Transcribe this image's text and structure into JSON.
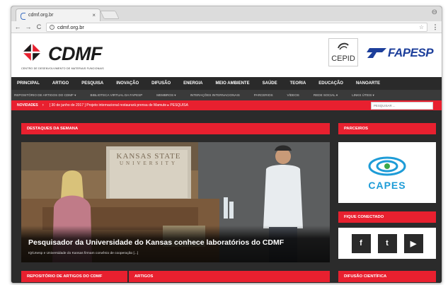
{
  "browser": {
    "tab_title": "cdmf.org.br",
    "tab_close": "×",
    "url": "cdmf.org.br",
    "back": "←",
    "forward": "→",
    "reload": "C",
    "info": "i",
    "star": "☆",
    "menu": "⋮",
    "profile": "⊖"
  },
  "header": {
    "brand": "CDMF",
    "tagline": "CENTRO DE DESENVOLVIMENTO DE MATERIAIS FUNCIONAIS",
    "cepid_label": "CEPID",
    "fapesp_label": "FAPESP"
  },
  "main_nav": [
    "PRINCIPAL",
    "ARTIGO",
    "PESQUISA",
    "INOVAÇÃO",
    "DIFUSÃO",
    "ENERGIA",
    "MEIO AMBIENTE",
    "SAÚDE",
    "TEORIA",
    "EDUCAÇÃO",
    "NANOARTE"
  ],
  "sub_nav": [
    "REPOSITÓRIO DE ARTIGOS DO CDMF ▾",
    "BIBLIOTECA VIRTUAL DA FAPESP",
    "MEMBROS ▾",
    "INTERAÇÕES INTERNACIONAIS",
    "PARCERIOS",
    "VÍDEOS",
    "REDE SOCIAL ▾",
    "LINKS ÚTEIS ▾"
  ],
  "ticker": {
    "label": "NOVIDADES",
    "arrow": "›",
    "text": "[ 30 de junho de 2017 ] Projeto internacional restaurará prensa de Mamute ▸ PESQUISA"
  },
  "search": {
    "placeholder": "PESQUISAR ..."
  },
  "sections": {
    "highlights": "DESTAQUES DA SEMANA",
    "partners": "PARCEIROS",
    "connected": "FIQUE CONECTADO",
    "repository": "REPOSITÓRIO DE ARTIGOS DO CDMF",
    "articles": "ARTIGOS",
    "diffusion": "DIFUSÃO CIENTÍFICA"
  },
  "hero": {
    "banner_line1": "KANSAS STATE",
    "banner_line2": "UNIVERSITY",
    "title": "Pesquisador da Universidade do Kansas conhece laboratórios do CDMF",
    "subtitle": "IQ/Unesp e Universidade do Kansas firmam convênio de cooperação [...]"
  },
  "partner": {
    "name": "CAPES"
  },
  "social": {
    "facebook": "f",
    "twitter": "t",
    "youtube": "▶"
  },
  "colors": {
    "accent": "#e8202f",
    "dark": "#2a2a2a",
    "capes_blue": "#1e9cd7",
    "fapesp_blue": "#1d3f9b"
  }
}
